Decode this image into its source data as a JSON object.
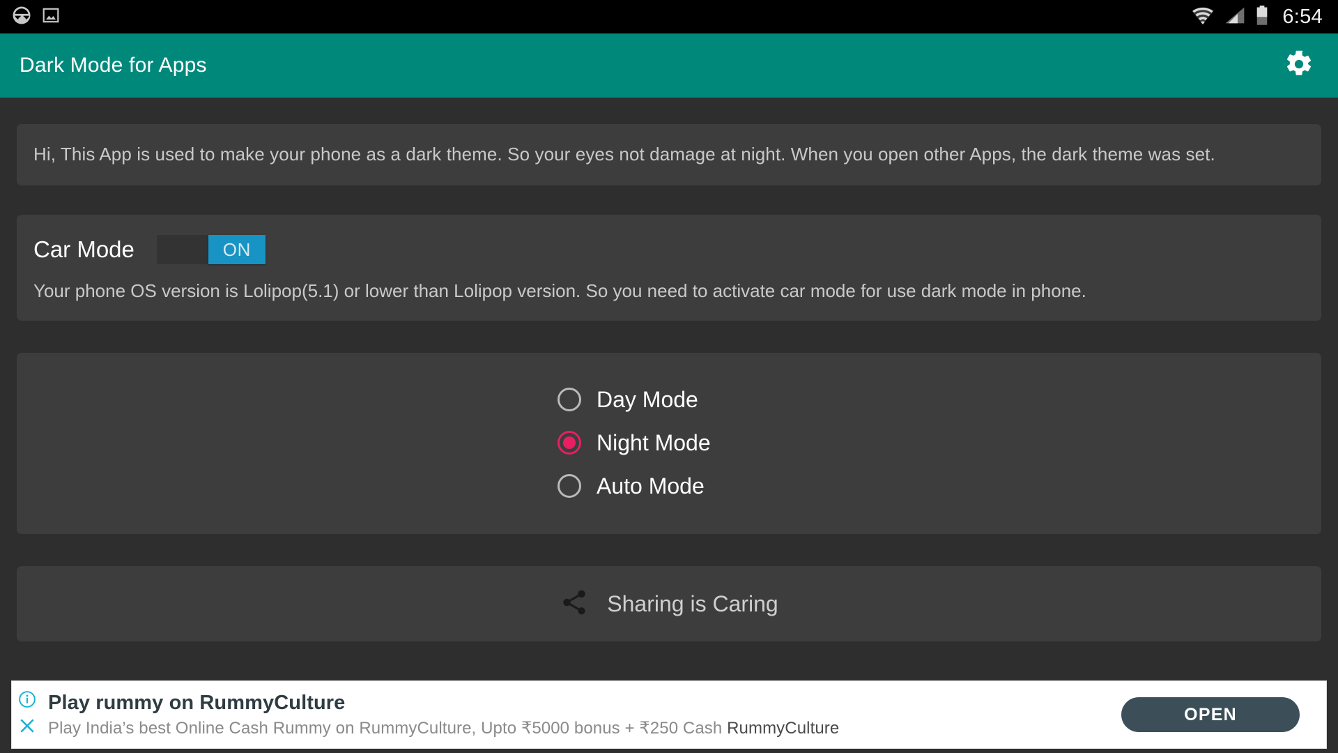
{
  "status_bar": {
    "time": "6:54",
    "left_icons": [
      "car-mode-icon",
      "screenshot-image-icon"
    ],
    "right_icons": [
      "wifi-icon",
      "signal-icon",
      "battery-icon"
    ],
    "background": "#000000"
  },
  "app_bar": {
    "title": "Dark Mode for Apps",
    "background": "#00897b",
    "settings_icon": "gear-icon"
  },
  "info_card": {
    "text": "Hi, This App is used to make your phone as a dark theme. So your eyes not damage at night. When you open other Apps, the dark theme was set."
  },
  "car_mode": {
    "label": "Car Mode",
    "switch_state": "ON",
    "switch_on_color": "#1794c4",
    "description": "Your phone OS version is Lolipop(5.1) or lower than Lolipop version. So you need to activate car mode for use dark mode in phone."
  },
  "modes": {
    "accent_color": "#e91e63",
    "selected": "Night Mode",
    "options": [
      {
        "label": "Day Mode",
        "checked": false
      },
      {
        "label": "Night Mode",
        "checked": true
      },
      {
        "label": "Auto Mode",
        "checked": false
      }
    ]
  },
  "share": {
    "label": "Sharing is Caring",
    "icon": "share-icon"
  },
  "ad": {
    "title": "Play rummy on RummyCulture",
    "subtitle_main": "Play India’s best Online Cash Rummy on RummyCulture, Upto ₹5000 bonus + ₹250 Cash ",
    "subtitle_brand": "RummyCulture",
    "cta_label": "OPEN",
    "info_icon": "info-circle-icon",
    "close_icon": "close-x-icon",
    "badge_color": "#14b3d6"
  }
}
